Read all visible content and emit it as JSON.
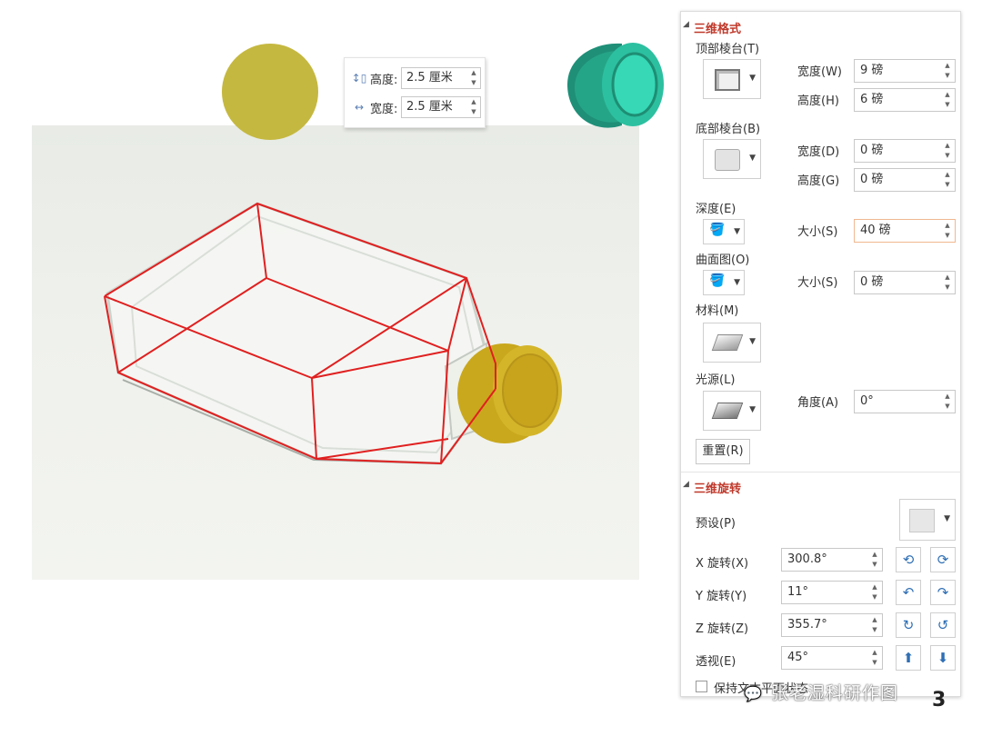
{
  "size_panel": {
    "height_label": "高度:",
    "height_value": "2.5 厘米",
    "width_label": "宽度:",
    "width_value": "2.5 厘米"
  },
  "format_panel": {
    "section_3d_format": "三维格式",
    "top_bevel_label": "顶部棱台(T)",
    "top_width_label": "宽度(W)",
    "top_width_value": "9 磅",
    "top_height_label": "高度(H)",
    "top_height_value": "6 磅",
    "bottom_bevel_label": "底部棱台(B)",
    "bottom_width_label": "宽度(D)",
    "bottom_width_value": "0 磅",
    "bottom_height_label": "高度(G)",
    "bottom_height_value": "0 磅",
    "depth_label": "深度(E)",
    "depth_size_label": "大小(S)",
    "depth_size_value": "40 磅",
    "contour_label": "曲面图(O)",
    "contour_size_label": "大小(S)",
    "contour_size_value": "0 磅",
    "material_label": "材料(M)",
    "lighting_label": "光源(L)",
    "angle_label": "角度(A)",
    "angle_value": "0°",
    "reset_label": "重置(R)",
    "section_3d_rotation": "三维旋转",
    "presets_label": "预设(P)",
    "x_rotation_label": "X 旋转(X)",
    "x_rotation_value": "300.8°",
    "y_rotation_label": "Y 旋转(Y)",
    "y_rotation_value": "11°",
    "z_rotation_label": "Z 旋转(Z)",
    "z_rotation_value": "355.7°",
    "perspective_label": "透视(E)",
    "perspective_value": "45°",
    "keep_text_flat_label": "保持文本平面状态"
  },
  "watermark": "张老湿科研作图",
  "page_number": "3",
  "colors": {
    "gold": "#c5b840",
    "teal": "#2ab89a",
    "accent_red": "#c0392b",
    "outline_red": "#e02020",
    "icon_blue": "#2f6fb5"
  },
  "icons": {
    "height": "height-arrows-icon",
    "width": "width-arrows-icon",
    "fill_bucket": "paint-bucket-icon",
    "rotate": "rotate-arrow-icon",
    "perspective_up": "arrow-up-icon",
    "perspective_down": "arrow-down-icon",
    "wechat": "wechat-icon"
  }
}
